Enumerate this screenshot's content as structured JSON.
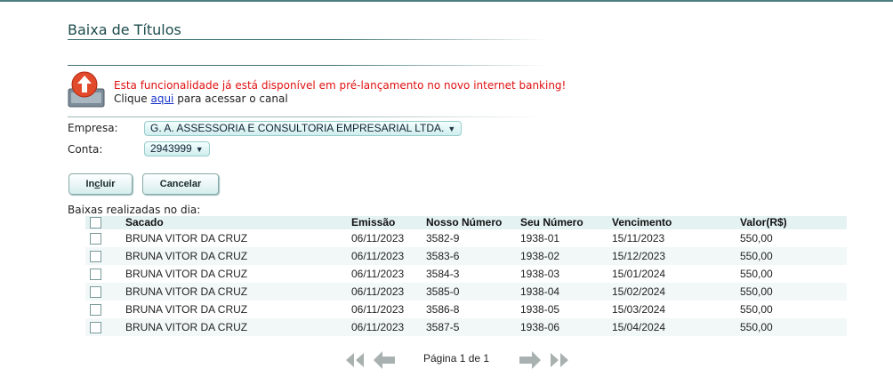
{
  "page": {
    "title": "Baixa de Títulos"
  },
  "notice": {
    "warning": "Esta funcionalidade já está disponível em pré-lançamento no novo internet banking!",
    "prefix": "Clique",
    "link": "aqui",
    "suffix": "para acessar o canal"
  },
  "form": {
    "empresa_label": "Empresa:",
    "empresa_value": "G. A. ASSESSORIA E CONSULTORIA EMPRESARIAL LTDA.",
    "conta_label": "Conta:",
    "conta_value": "2943999"
  },
  "buttons": {
    "incluir_pre": "In",
    "incluir_u": "c",
    "incluir_post": "luir",
    "cancelar": "Cancelar"
  },
  "table": {
    "caption": "Baixas realizadas no dia:",
    "headers": {
      "sacado": "Sacado",
      "emissao": "Emissão",
      "nosso": "Nosso Número",
      "seu": "Seu Número",
      "vencimento": "Vencimento",
      "valor": "Valor(R$)"
    },
    "rows": [
      {
        "sacado": "BRUNA VITOR DA CRUZ",
        "emissao": "06/11/2023",
        "nosso": "3582-9",
        "seu": "1938-01",
        "vencimento": "15/11/2023",
        "valor": "550,00"
      },
      {
        "sacado": "BRUNA VITOR DA CRUZ",
        "emissao": "06/11/2023",
        "nosso": "3583-6",
        "seu": "1938-02",
        "vencimento": "15/12/2023",
        "valor": "550,00"
      },
      {
        "sacado": "BRUNA VITOR DA CRUZ",
        "emissao": "06/11/2023",
        "nosso": "3584-3",
        "seu": "1938-03",
        "vencimento": "15/01/2024",
        "valor": "550,00"
      },
      {
        "sacado": "BRUNA VITOR DA CRUZ",
        "emissao": "06/11/2023",
        "nosso": "3585-0",
        "seu": "1938-04",
        "vencimento": "15/02/2024",
        "valor": "550,00"
      },
      {
        "sacado": "BRUNA VITOR DA CRUZ",
        "emissao": "06/11/2023",
        "nosso": "3586-8",
        "seu": "1938-05",
        "vencimento": "15/03/2024",
        "valor": "550,00"
      },
      {
        "sacado": "BRUNA VITOR DA CRUZ",
        "emissao": "06/11/2023",
        "nosso": "3587-5",
        "seu": "1938-06",
        "vencimento": "15/04/2024",
        "valor": "550,00"
      }
    ]
  },
  "pager": {
    "label": "Página 1 de 1"
  },
  "icons": {
    "notice": "upload-alert-icon",
    "first": "first-page-icon",
    "prev": "prev-page-icon",
    "next": "next-page-icon",
    "last": "last-page-icon"
  },
  "colors": {
    "accent": "#1d4b4b",
    "warning": "#e01010",
    "link": "#1a35c8",
    "header_bg": "#e5f2f2"
  }
}
